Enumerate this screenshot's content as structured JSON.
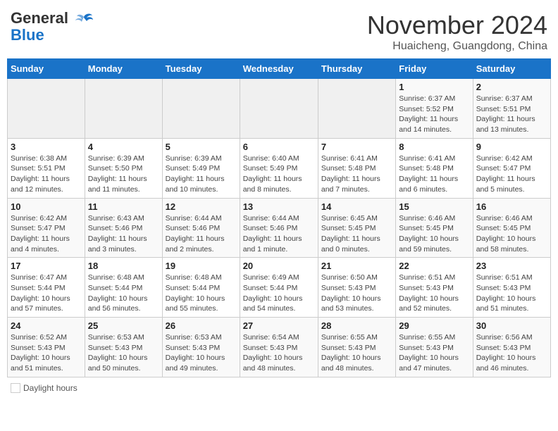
{
  "header": {
    "logo_line1": "General",
    "logo_line2": "Blue",
    "month": "November 2024",
    "location": "Huaicheng, Guangdong, China"
  },
  "days_of_week": [
    "Sunday",
    "Monday",
    "Tuesday",
    "Wednesday",
    "Thursday",
    "Friday",
    "Saturday"
  ],
  "weeks": [
    [
      {
        "num": "",
        "info": ""
      },
      {
        "num": "",
        "info": ""
      },
      {
        "num": "",
        "info": ""
      },
      {
        "num": "",
        "info": ""
      },
      {
        "num": "",
        "info": ""
      },
      {
        "num": "1",
        "info": "Sunrise: 6:37 AM\nSunset: 5:52 PM\nDaylight: 11 hours and 14 minutes."
      },
      {
        "num": "2",
        "info": "Sunrise: 6:37 AM\nSunset: 5:51 PM\nDaylight: 11 hours and 13 minutes."
      }
    ],
    [
      {
        "num": "3",
        "info": "Sunrise: 6:38 AM\nSunset: 5:51 PM\nDaylight: 11 hours and 12 minutes."
      },
      {
        "num": "4",
        "info": "Sunrise: 6:39 AM\nSunset: 5:50 PM\nDaylight: 11 hours and 11 minutes."
      },
      {
        "num": "5",
        "info": "Sunrise: 6:39 AM\nSunset: 5:49 PM\nDaylight: 11 hours and 10 minutes."
      },
      {
        "num": "6",
        "info": "Sunrise: 6:40 AM\nSunset: 5:49 PM\nDaylight: 11 hours and 8 minutes."
      },
      {
        "num": "7",
        "info": "Sunrise: 6:41 AM\nSunset: 5:48 PM\nDaylight: 11 hours and 7 minutes."
      },
      {
        "num": "8",
        "info": "Sunrise: 6:41 AM\nSunset: 5:48 PM\nDaylight: 11 hours and 6 minutes."
      },
      {
        "num": "9",
        "info": "Sunrise: 6:42 AM\nSunset: 5:47 PM\nDaylight: 11 hours and 5 minutes."
      }
    ],
    [
      {
        "num": "10",
        "info": "Sunrise: 6:42 AM\nSunset: 5:47 PM\nDaylight: 11 hours and 4 minutes."
      },
      {
        "num": "11",
        "info": "Sunrise: 6:43 AM\nSunset: 5:46 PM\nDaylight: 11 hours and 3 minutes."
      },
      {
        "num": "12",
        "info": "Sunrise: 6:44 AM\nSunset: 5:46 PM\nDaylight: 11 hours and 2 minutes."
      },
      {
        "num": "13",
        "info": "Sunrise: 6:44 AM\nSunset: 5:46 PM\nDaylight: 11 hours and 1 minute."
      },
      {
        "num": "14",
        "info": "Sunrise: 6:45 AM\nSunset: 5:45 PM\nDaylight: 11 hours and 0 minutes."
      },
      {
        "num": "15",
        "info": "Sunrise: 6:46 AM\nSunset: 5:45 PM\nDaylight: 10 hours and 59 minutes."
      },
      {
        "num": "16",
        "info": "Sunrise: 6:46 AM\nSunset: 5:45 PM\nDaylight: 10 hours and 58 minutes."
      }
    ],
    [
      {
        "num": "17",
        "info": "Sunrise: 6:47 AM\nSunset: 5:44 PM\nDaylight: 10 hours and 57 minutes."
      },
      {
        "num": "18",
        "info": "Sunrise: 6:48 AM\nSunset: 5:44 PM\nDaylight: 10 hours and 56 minutes."
      },
      {
        "num": "19",
        "info": "Sunrise: 6:48 AM\nSunset: 5:44 PM\nDaylight: 10 hours and 55 minutes."
      },
      {
        "num": "20",
        "info": "Sunrise: 6:49 AM\nSunset: 5:44 PM\nDaylight: 10 hours and 54 minutes."
      },
      {
        "num": "21",
        "info": "Sunrise: 6:50 AM\nSunset: 5:43 PM\nDaylight: 10 hours and 53 minutes."
      },
      {
        "num": "22",
        "info": "Sunrise: 6:51 AM\nSunset: 5:43 PM\nDaylight: 10 hours and 52 minutes."
      },
      {
        "num": "23",
        "info": "Sunrise: 6:51 AM\nSunset: 5:43 PM\nDaylight: 10 hours and 51 minutes."
      }
    ],
    [
      {
        "num": "24",
        "info": "Sunrise: 6:52 AM\nSunset: 5:43 PM\nDaylight: 10 hours and 51 minutes."
      },
      {
        "num": "25",
        "info": "Sunrise: 6:53 AM\nSunset: 5:43 PM\nDaylight: 10 hours and 50 minutes."
      },
      {
        "num": "26",
        "info": "Sunrise: 6:53 AM\nSunset: 5:43 PM\nDaylight: 10 hours and 49 minutes."
      },
      {
        "num": "27",
        "info": "Sunrise: 6:54 AM\nSunset: 5:43 PM\nDaylight: 10 hours and 48 minutes."
      },
      {
        "num": "28",
        "info": "Sunrise: 6:55 AM\nSunset: 5:43 PM\nDaylight: 10 hours and 48 minutes."
      },
      {
        "num": "29",
        "info": "Sunrise: 6:55 AM\nSunset: 5:43 PM\nDaylight: 10 hours and 47 minutes."
      },
      {
        "num": "30",
        "info": "Sunrise: 6:56 AM\nSunset: 5:43 PM\nDaylight: 10 hours and 46 minutes."
      }
    ]
  ],
  "legend": {
    "daylight_label": "Daylight hours"
  }
}
